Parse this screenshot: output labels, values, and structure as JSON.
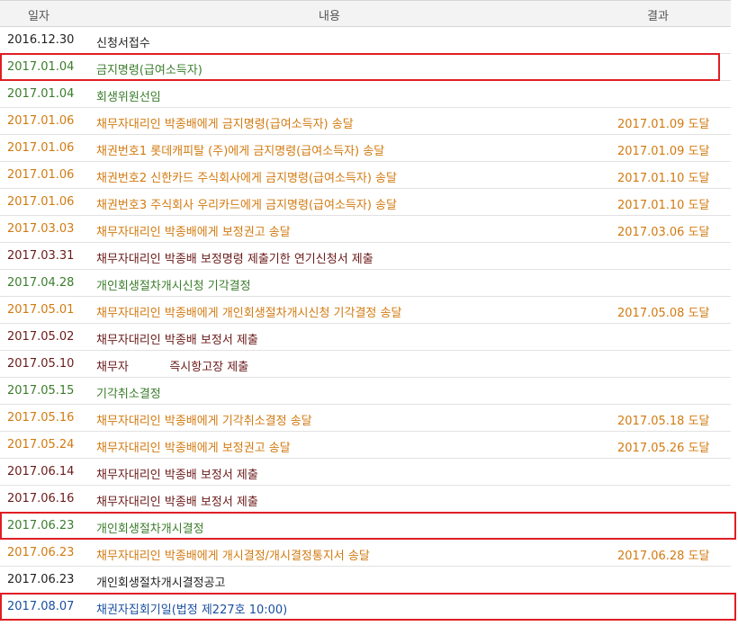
{
  "header": {
    "date": "일자",
    "content": "내용",
    "result": "결과"
  },
  "rows": [
    {
      "date": "2016.12.30",
      "content": "신청서접수",
      "result": "",
      "color": "black"
    },
    {
      "date": "2017.01.04",
      "content": "금지명령(급여소득자)",
      "result": "",
      "color": "green"
    },
    {
      "date": "2017.01.04",
      "content": "회생위원선임",
      "result": "",
      "color": "green"
    },
    {
      "date": "2017.01.06",
      "content": "채무자대리인 박종배에게 금지명령(급여소득자) 송달",
      "result": "2017.01.09 도달",
      "color": "orange"
    },
    {
      "date": "2017.01.06",
      "content": "채권번호1 롯데캐피탈 (주)에게 금지명령(급여소득자) 송달",
      "result": "2017.01.09 도달",
      "color": "orange"
    },
    {
      "date": "2017.01.06",
      "content": "채권번호2 신한카드 주식회사에게 금지명령(급여소득자) 송달",
      "result": "2017.01.10 도달",
      "color": "orange"
    },
    {
      "date": "2017.01.06",
      "content": "채권번호3 주식회사 우리카드에게 금지명령(급여소득자) 송달",
      "result": "2017.01.10 도달",
      "color": "orange"
    },
    {
      "date": "2017.03.03",
      "content": "채무자대리인 박종배에게 보정권고 송달",
      "result": "2017.03.06 도달",
      "color": "orange"
    },
    {
      "date": "2017.03.31",
      "content": "채무자대리인 박종배 보정명령 제출기한 연기신청서 제출",
      "result": "",
      "color": "brown"
    },
    {
      "date": "2017.04.28",
      "content": "개인회생절차개시신청 기각결정",
      "result": "",
      "color": "green"
    },
    {
      "date": "2017.05.01",
      "content": "채무자대리인 박종배에게 개인회생절차개시신청 기각결정 송달",
      "result": "2017.05.08 도달",
      "color": "orange"
    },
    {
      "date": "2017.05.02",
      "content": "채무자대리인 박종배 보정서 제출",
      "result": "",
      "color": "brown"
    },
    {
      "date": "2017.05.10",
      "content": "채무자           즉시항고장 제출",
      "result": "",
      "color": "brown"
    },
    {
      "date": "2017.05.15",
      "content": "기각취소결정",
      "result": "",
      "color": "green"
    },
    {
      "date": "2017.05.16",
      "content": "채무자대리인 박종배에게 기각취소결정 송달",
      "result": "2017.05.18 도달",
      "color": "orange"
    },
    {
      "date": "2017.05.24",
      "content": "채무자대리인 박종배에게 보정권고 송달",
      "result": "2017.05.26 도달",
      "color": "orange"
    },
    {
      "date": "2017.06.14",
      "content": "채무자대리인 박종배 보정서 제출",
      "result": "",
      "color": "brown"
    },
    {
      "date": "2017.06.16",
      "content": "채무자대리인 박종배 보정서 제출",
      "result": "",
      "color": "brown"
    },
    {
      "date": "2017.06.23",
      "content": "개인회생절차개시결정",
      "result": "",
      "color": "green"
    },
    {
      "date": "2017.06.23",
      "content": "채무자대리인 박종배에게 개시결정/개시결정통지서 송달",
      "result": "2017.06.28 도달",
      "color": "orange"
    },
    {
      "date": "2017.06.23",
      "content": "개인회생절차개시결정공고",
      "result": "",
      "color": "black"
    },
    {
      "date": "2017.08.07",
      "content": "채권자집회기일(법정 제227호 10:00)",
      "result": "",
      "color": "blue"
    }
  ],
  "highlighted_rows": [
    1,
    18,
    21
  ]
}
